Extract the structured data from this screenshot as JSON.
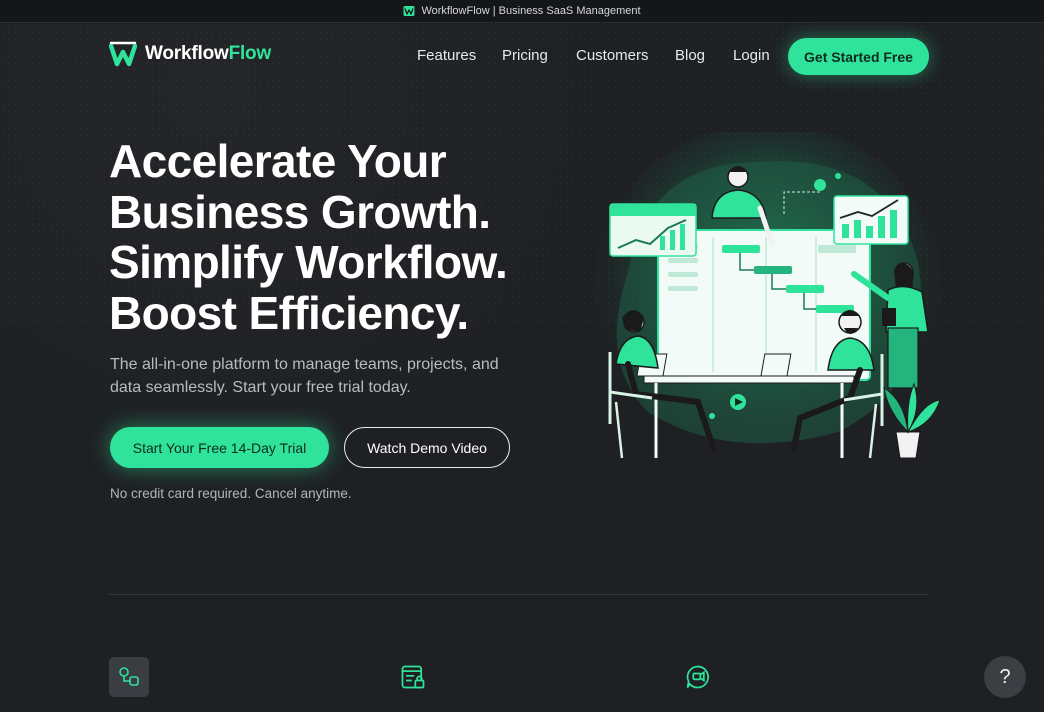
{
  "window": {
    "title": "WorkflowFlow | Business SaaS Management"
  },
  "brand": {
    "name_part1": "Workflow",
    "name_part2": "Flow",
    "accent_color": "#2fe39b"
  },
  "nav": {
    "items": [
      "Features",
      "Pricing",
      "Customers",
      "Blog",
      "Login"
    ],
    "cta_label": "Get Started Free"
  },
  "hero": {
    "title_lines": [
      "Accelerate Your",
      "Business Growth.",
      "Simplify Workflow.",
      "Boost Efficiency."
    ],
    "subtitle": "The all-in-one platform to manage teams, projects, and data seamlessly. Start your free trial today.",
    "primary_cta": "Start Your Free 14-Day Trial",
    "secondary_cta": "Watch Demo Video",
    "note": "No credit card required. Cancel anytime."
  },
  "features": {
    "icons": [
      "team-connect-icon",
      "secure-document-icon",
      "chat-support-icon"
    ]
  },
  "help": {
    "label": "?"
  }
}
